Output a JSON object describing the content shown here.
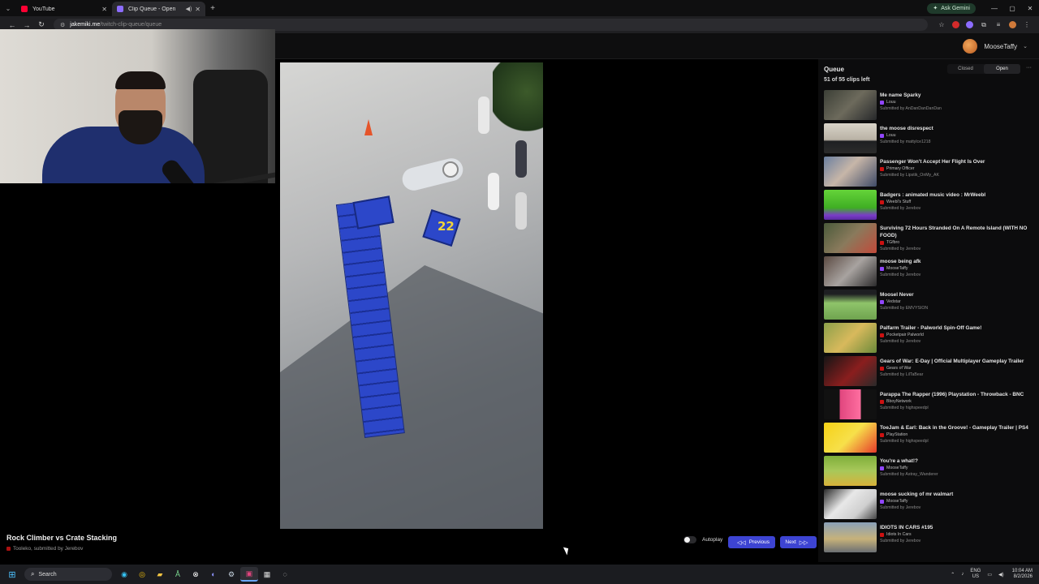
{
  "browser": {
    "tabs": [
      {
        "title": "YouTube",
        "close": "✕",
        "favicon_color": "#ff0033"
      },
      {
        "title": "Clip Queue - Open",
        "close": "✕",
        "favicon_color": "#8c6cff"
      }
    ],
    "ask_gemini": "Ask Gemini",
    "url_host": "jakemiki.me",
    "url_path": "/twitch-clip-queue/queue"
  },
  "header": {
    "username": "MooseTaffy"
  },
  "queue": {
    "title": "Queue",
    "count": "51 of 55 clips left",
    "toggle_closed": "Closed",
    "toggle_open": "Open",
    "items": [
      {
        "title": "Me name Sparky",
        "channel": "Louu",
        "submitted": "Submitted by AnDanDanDanDan",
        "icon_color": "#9146ff",
        "thumb": "linear-gradient(135deg,#3b3f36,#6d6a5c 50%,#26282a)"
      },
      {
        "title": "the moose disrespect",
        "channel": "Louu",
        "submitted": "Submitted by mattylce1218",
        "icon_color": "#9146ff",
        "thumb": "linear-gradient(180deg,#d8d3c8,#b9b2a5 55%,#1f2022 60%,#2b2b2b)"
      },
      {
        "title": "Passenger Won't Accept Her Flight Is Over",
        "channel": "Primary Officer",
        "submitted": "Submitted by Lipstik_OnMy_AK",
        "icon_color": "#cc1111",
        "thumb": "linear-gradient(135deg,#6b7fa0,#c7b6a8 45%,#3f4b67)"
      },
      {
        "title": "Badgers : animated music video : MrWeebl",
        "channel": "Weebl's Stuff",
        "submitted": "Submitted by Jerebov",
        "icon_color": "#cc1111",
        "thumb": "linear-gradient(180deg,#65d43a,#3fae23 60%,#7a3cc8 85%,#5b2aa3)"
      },
      {
        "title": "Surviving 72 Hours Stranded On A Remote Island (WITH NO FOOD)",
        "channel": "TGfbro",
        "submitted": "Submitted by Jerebov",
        "icon_color": "#cc1111",
        "thumb": "linear-gradient(135deg,#4a5a3a,#8a7a5c 50%,#c24a3a)"
      },
      {
        "title": "moose being afk",
        "channel": "MooseTaffy",
        "submitted": "Submitted by Jerebov",
        "icon_color": "#9146ff",
        "thumb": "linear-gradient(135deg,#5b4a42,#a8a3a0 50%,#2c2b2c)"
      },
      {
        "title": "Moosel Never",
        "channel": "Vedstar",
        "submitted": "Submitted by EMVYSION",
        "icon_color": "#9146ff",
        "thumb": "linear-gradient(180deg,#1e1f22 15%,#8fc46a 45%,#6fa34f)"
      },
      {
        "title": "Palfarm Trailer - Palworld Spin-Off Game!",
        "channel": "Pocketpair Palworld",
        "submitted": "Submitted by Jerebov",
        "icon_color": "#cc1111",
        "thumb": "linear-gradient(135deg,#8ca04a,#d8b95c 50%,#6b8a3a)"
      },
      {
        "title": "Gears of War: E-Day | Official Multiplayer Gameplay Trailer",
        "channel": "Gears of War",
        "submitted": "Submitted by LilTaBear",
        "icon_color": "#cc1111",
        "thumb": "linear-gradient(135deg,#151515,#8a1e1e 55%,#2a2a2a)"
      },
      {
        "title": "Parappa The Rapper (1996) Playstation - Throwback - BNC",
        "channel": "BboyNetwork",
        "submitted": "Submitted by highspeedpl",
        "icon_color": "#cc1111",
        "thumb": "linear-gradient(90deg,#111 30%,#e0457e 30%,#ff6fa0 70%,#111 70%)"
      },
      {
        "title": "ToeJam & Earl: Back in the Groove! - Gameplay Trailer | PS4",
        "channel": "PlayStation",
        "submitted": "Submitted by highspeedpl",
        "icon_color": "#cc1111",
        "thumb": "linear-gradient(135deg,#f5d116,#f7e04a 50%,#e63a2a)"
      },
      {
        "title": "You're a what!?",
        "channel": "MooseTaffy",
        "submitted": "Submitted by Astray_Wanderer",
        "icon_color": "#9146ff",
        "thumb": "linear-gradient(180deg,#7fae3a,#a8c85a 50%,#d8b23a)"
      },
      {
        "title": "moose sucking of mr walmart",
        "channel": "MooseTaffy",
        "submitted": "Submitted by Jerebov",
        "icon_color": "#9146ff",
        "thumb": "linear-gradient(135deg,#2a2a2a,#e8e8e8 40%,#cfcfcf 70%,#444)"
      },
      {
        "title": "IDIOTS IN CARS #195",
        "channel": "Idiots In Cars",
        "submitted": "Submitted by Jerebov",
        "icon_color": "#cc1111",
        "thumb": "linear-gradient(180deg,#8aa0b8,#c7b27a 55%,#6b6f73)"
      }
    ]
  },
  "current_clip": {
    "title": "Rock Climber vs Crate Stacking",
    "channel": "Tooleko",
    "submitted": ", submitted by Jerebov",
    "overlay_number": "22"
  },
  "controls": {
    "autoplay_label": "Autoplay",
    "prev_label": "Previous",
    "next_label": "Next"
  },
  "taskbar": {
    "search_placeholder": "Search",
    "lang_line1": "ENG",
    "lang_line2": "US",
    "time": "10:04 AM",
    "date": "8/2/2026"
  },
  "colors": {
    "accent": "#3d44d3",
    "twitch": "#9146ff",
    "youtube": "#cc1111"
  }
}
